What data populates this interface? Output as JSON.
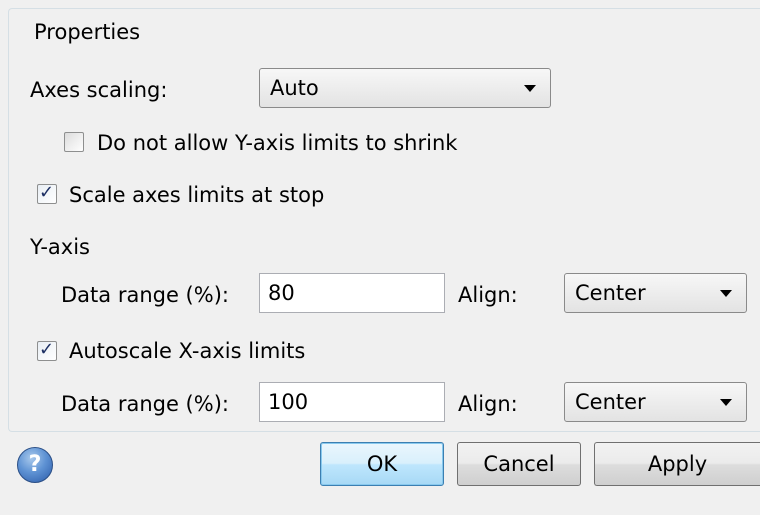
{
  "group": {
    "title": "Properties"
  },
  "axes_scaling": {
    "label": "Axes scaling:",
    "value": "Auto"
  },
  "options": {
    "no_shrink_label": "Do not allow Y-axis limits to shrink",
    "no_shrink_checked": false,
    "scale_at_stop_label": "Scale axes limits at stop",
    "scale_at_stop_checked": true
  },
  "y_axis": {
    "heading": "Y-axis",
    "data_range_label": "Data range (%):",
    "data_range_value": "80",
    "align_label": "Align:",
    "align_value": "Center"
  },
  "x_axis": {
    "autoscale_label": "Autoscale X-axis limits",
    "autoscale_checked": true,
    "data_range_label": "Data range (%):",
    "data_range_value": "100",
    "align_label": "Align:",
    "align_value": "Center"
  },
  "buttons": {
    "help_glyph": "?",
    "ok": "OK",
    "cancel": "Cancel",
    "apply": "Apply"
  },
  "glyphs": {
    "check": "✓"
  }
}
